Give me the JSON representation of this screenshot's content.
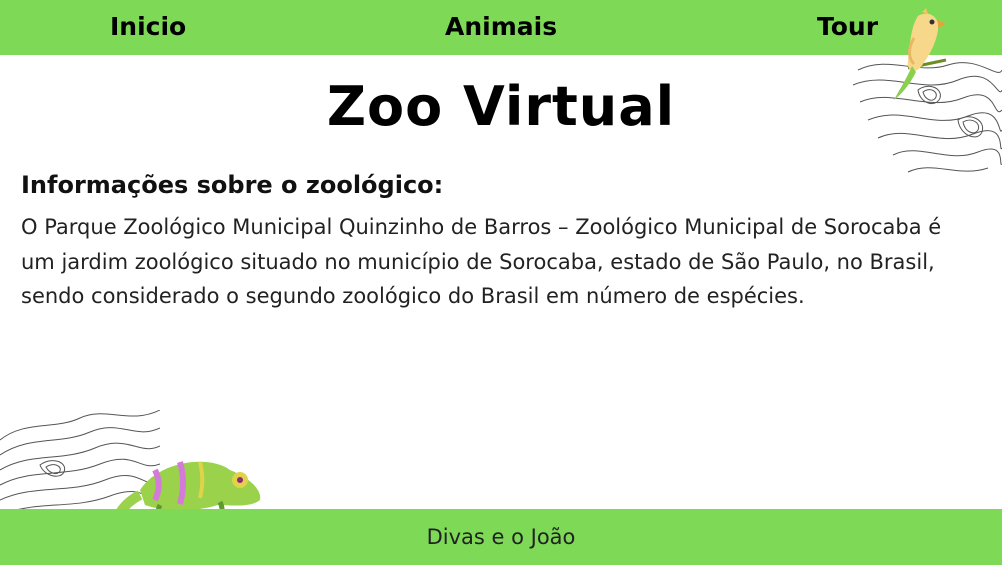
{
  "nav": {
    "items": [
      {
        "label": "Inicio"
      },
      {
        "label": "Animais"
      },
      {
        "label": "Tour"
      }
    ]
  },
  "header": {
    "title": "Zoo Virtual"
  },
  "info": {
    "heading": "Informações sobre o zoológico:",
    "text": "O Parque Zoológico Municipal Quinzinho de Barros – Zoológico Municipal de Sorocaba é um jardim zoológico situado no município de Sorocaba, estado de São Paulo, no Brasil, sendo considerado o segundo zoológico do Brasil em número de espécies."
  },
  "footer": {
    "text": "Divas e o João"
  },
  "colors": {
    "accent": "#7ed957"
  },
  "icons": [
    "parrot-illustration",
    "chameleon-illustration",
    "topographic-pattern"
  ]
}
